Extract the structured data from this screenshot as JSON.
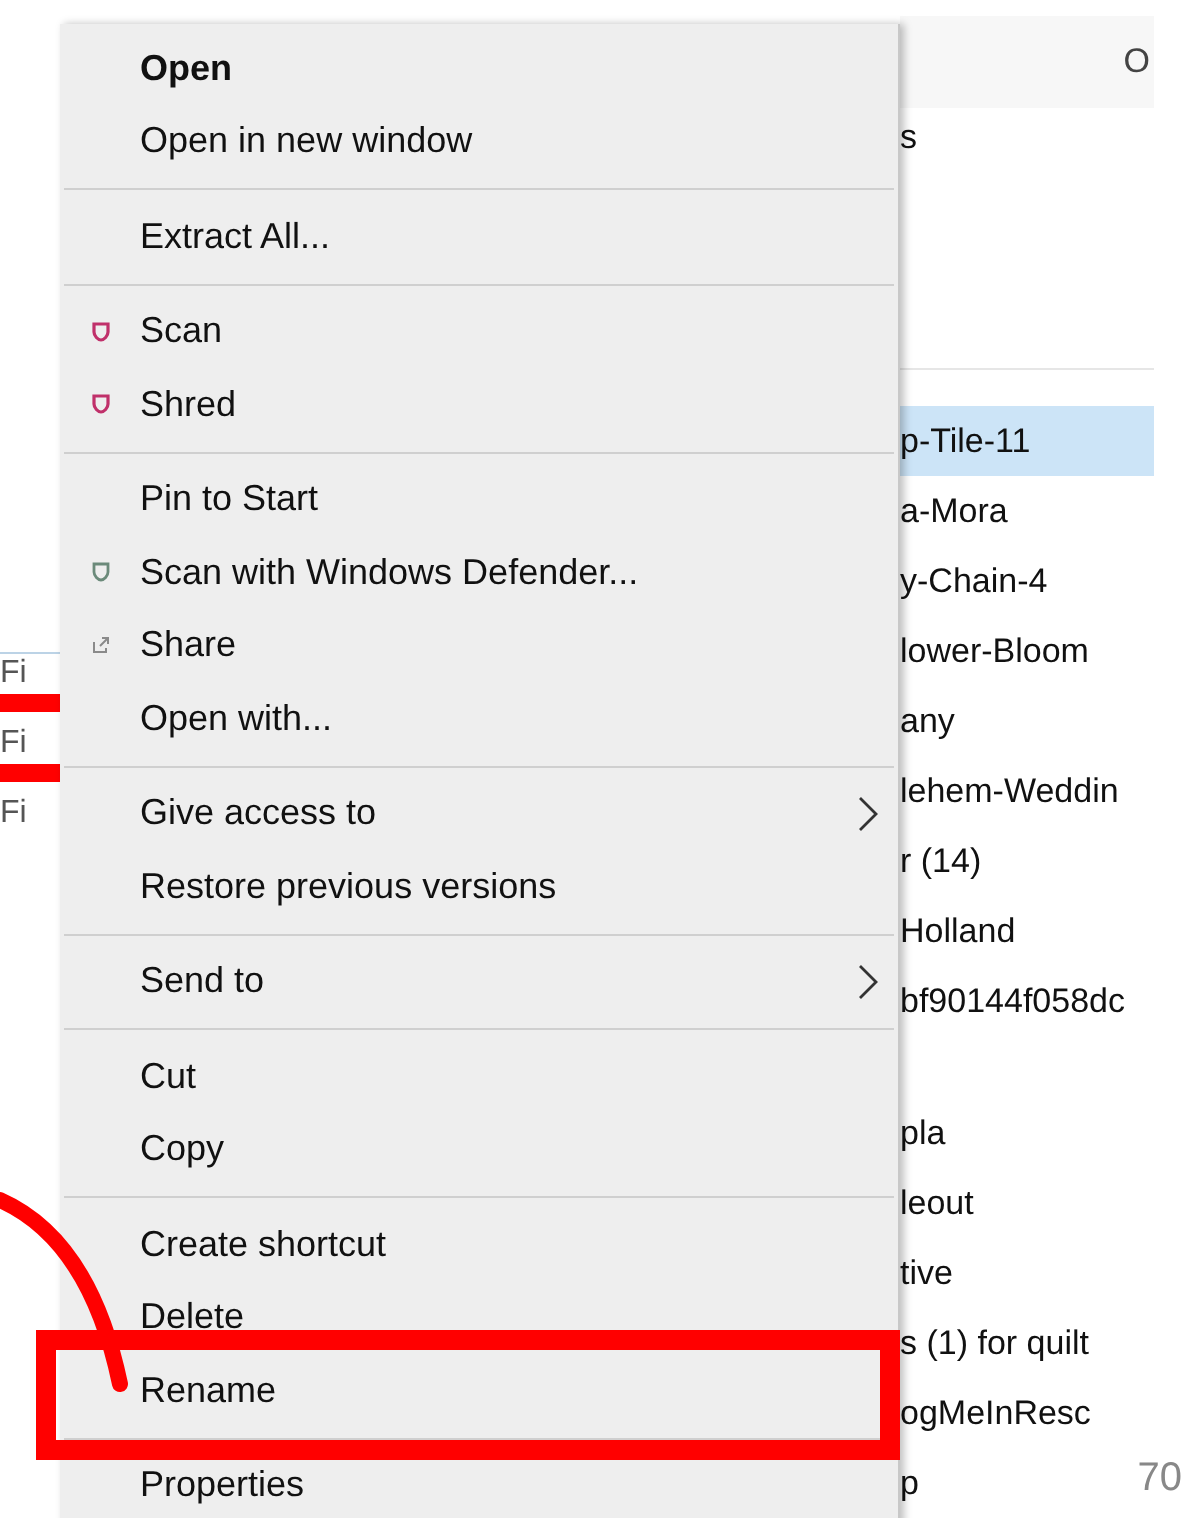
{
  "left_list": [
    "Fi",
    "Fi",
    "Fi"
  ],
  "menu": {
    "sections": [
      [
        {
          "label": "Open",
          "default": true,
          "kind": "plain",
          "submenu": false
        },
        {
          "label": "Open in new window",
          "default": false,
          "kind": "plain",
          "submenu": false
        }
      ],
      [
        {
          "label": "Extract All...",
          "default": false,
          "kind": "plain",
          "submenu": false
        }
      ],
      [
        {
          "label": "Scan",
          "default": false,
          "kind": "shield",
          "submenu": false
        },
        {
          "label": "Shred",
          "default": false,
          "kind": "shield",
          "submenu": false
        }
      ],
      [
        {
          "label": "Pin to Start",
          "default": false,
          "kind": "plain",
          "submenu": false
        },
        {
          "label": "Scan with Windows Defender...",
          "default": false,
          "kind": "defender",
          "submenu": false
        },
        {
          "label": "Share",
          "default": false,
          "kind": "share",
          "submenu": false
        },
        {
          "label": "Open with...",
          "default": false,
          "kind": "plain",
          "submenu": false
        }
      ],
      [
        {
          "label": "Give access to",
          "default": false,
          "kind": "plain",
          "submenu": true
        },
        {
          "label": "Restore previous versions",
          "default": false,
          "kind": "plain",
          "submenu": false
        }
      ],
      [
        {
          "label": "Send to",
          "default": false,
          "kind": "plain",
          "submenu": true
        }
      ],
      [
        {
          "label": "Cut",
          "default": false,
          "kind": "plain",
          "submenu": false
        },
        {
          "label": "Copy",
          "default": false,
          "kind": "plain",
          "submenu": false
        }
      ],
      [
        {
          "label": "Create shortcut",
          "default": false,
          "kind": "plain",
          "submenu": false
        },
        {
          "label": "Delete",
          "default": false,
          "kind": "plain",
          "submenu": false
        },
        {
          "label": "Rename",
          "default": false,
          "kind": "plain",
          "submenu": false
        }
      ],
      [
        {
          "label": "Properties",
          "default": false,
          "kind": "plain",
          "submenu": false
        }
      ]
    ]
  },
  "file_list": {
    "header": "O",
    "top_item": "s",
    "rows": [
      {
        "name": "p-Tile-11",
        "selected": true
      },
      {
        "name": "a-Mora",
        "selected": false
      },
      {
        "name": "y-Chain-4",
        "selected": false
      },
      {
        "name": "lower-Bloom",
        "selected": false
      },
      {
        "name": "any",
        "selected": false
      },
      {
        "name": "lehem-Weddin",
        "selected": false
      },
      {
        "name": "r (14)",
        "selected": false
      },
      {
        "name": "Holland",
        "selected": false
      },
      {
        "name": "bf90144f058dc",
        "selected": false
      },
      {
        "name": "",
        "selected": false
      },
      {
        "name": "pla",
        "selected": false
      },
      {
        "name": "leout",
        "selected": false
      },
      {
        "name": "tive",
        "selected": false
      },
      {
        "name": "s (1) for quilt",
        "selected": false
      },
      {
        "name": "ogMeInResc",
        "selected": false
      },
      {
        "name": "p",
        "selected": false
      }
    ]
  },
  "page_number": "70"
}
